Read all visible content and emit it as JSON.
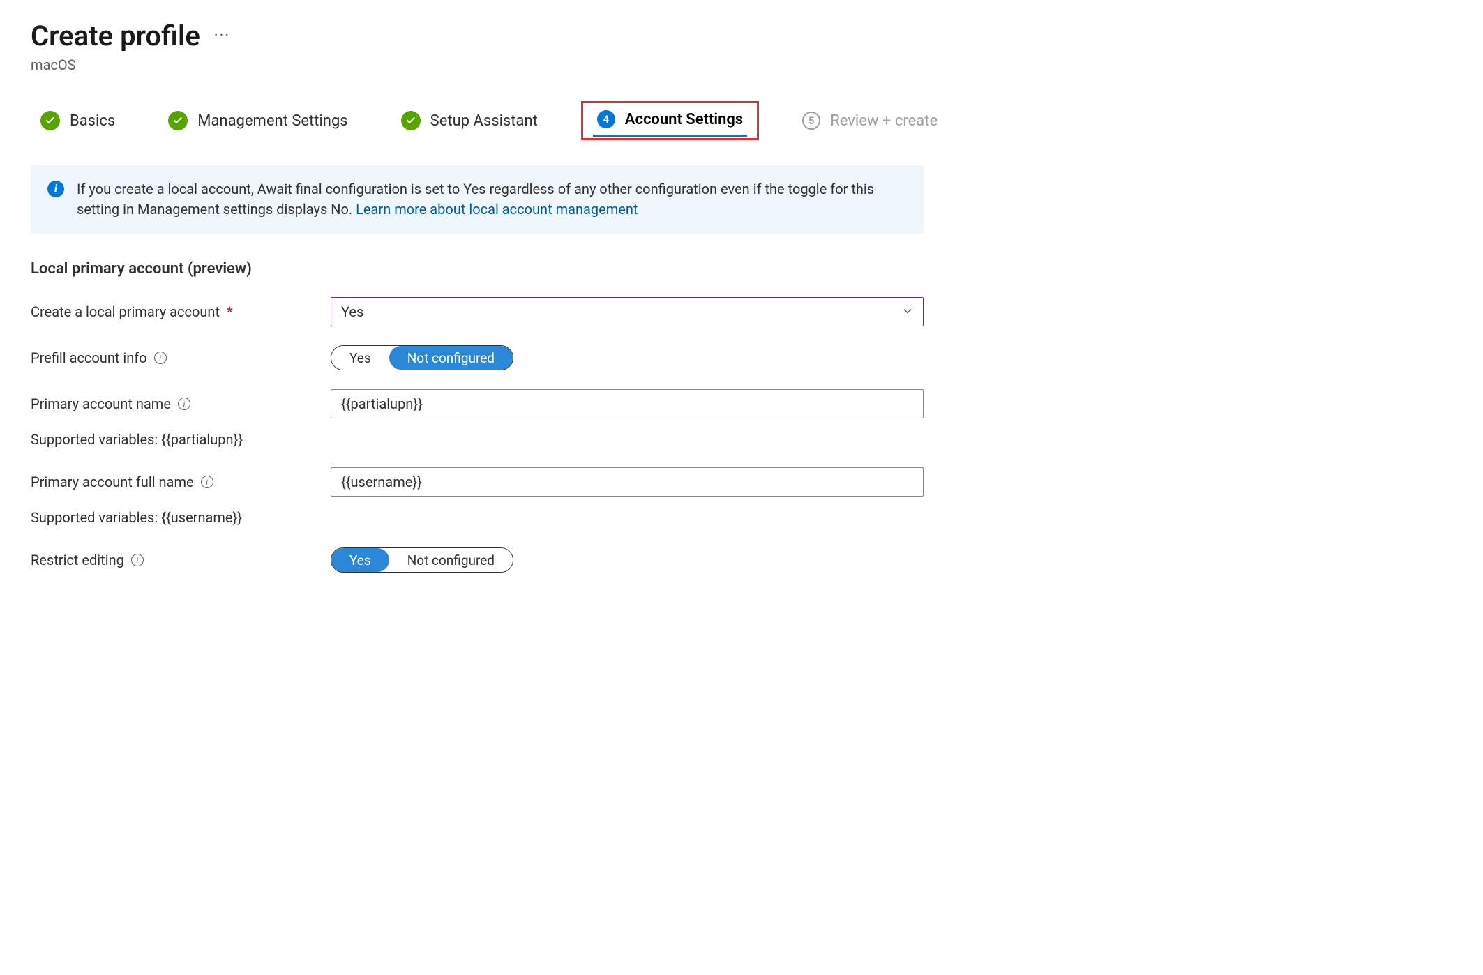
{
  "header": {
    "title": "Create profile",
    "subtitle": "macOS"
  },
  "steps": [
    {
      "label": "Basics",
      "state": "done"
    },
    {
      "label": "Management Settings",
      "state": "done"
    },
    {
      "label": "Setup Assistant",
      "state": "done"
    },
    {
      "label": "Account Settings",
      "state": "current",
      "number": "4"
    },
    {
      "label": "Review + create",
      "state": "future",
      "number": "5"
    }
  ],
  "infobox": {
    "message": "If you create a local account, Await final configuration is set to Yes regardless of any other configuration even if the toggle for this setting in Management settings displays No. ",
    "link_text": "Learn more about local account management"
  },
  "section": {
    "title": "Local primary account (preview)"
  },
  "form": {
    "create_local": {
      "label": "Create a local primary account",
      "required": true,
      "value": "Yes"
    },
    "prefill": {
      "label": "Prefill account info",
      "options": [
        "Yes",
        "Not configured"
      ],
      "selected": "Not configured"
    },
    "account_name": {
      "label": "Primary account name",
      "value": "{{partialupn}}",
      "hint": "Supported variables: {{partialupn}}"
    },
    "full_name": {
      "label": "Primary account full name",
      "value": "{{username}}",
      "hint": "Supported variables: {{username}}"
    },
    "restrict": {
      "label": "Restrict editing",
      "options": [
        "Yes",
        "Not configured"
      ],
      "selected": "Yes"
    }
  }
}
